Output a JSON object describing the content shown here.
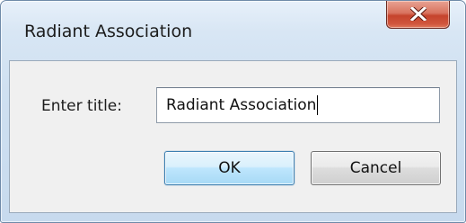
{
  "window": {
    "title": "Radiant Association"
  },
  "titlebar": {
    "close_icon": "close-icon"
  },
  "form": {
    "label": "Enter title:",
    "input_value": "Radiant Association"
  },
  "buttons": {
    "ok_label": "OK",
    "cancel_label": "Cancel"
  },
  "colors": {
    "close_button": "#c5432c",
    "ok_border": "#3c7fb1",
    "content_bg": "#f0f0f0"
  }
}
